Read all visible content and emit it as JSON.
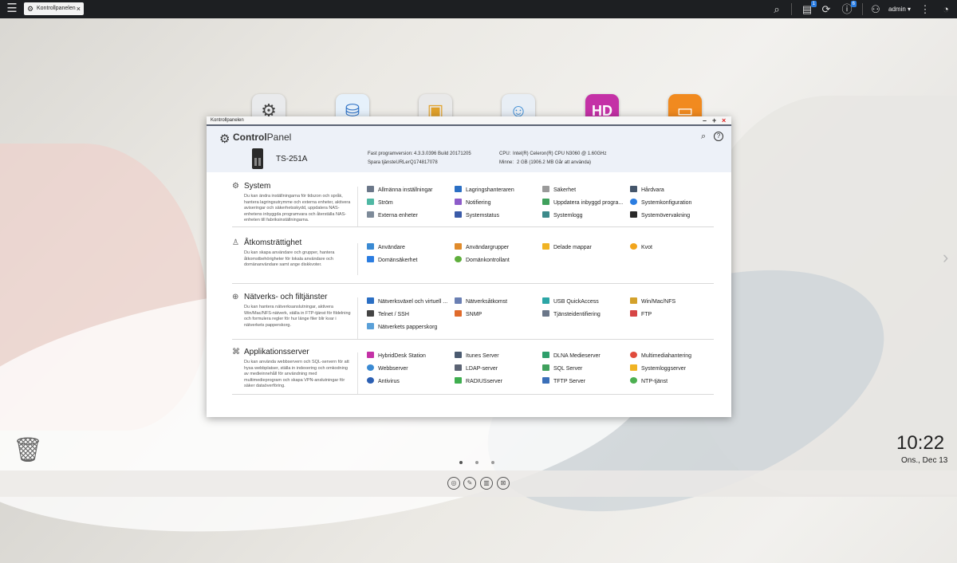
{
  "topbar": {
    "menu_icon": "hamburger-icon",
    "tab_label": "Kontrollpanelen",
    "tab_close": "×",
    "badges": {
      "tasks": "1",
      "info": "6"
    },
    "user": "admin ▾"
  },
  "desktop_icons": [
    "gear-icon",
    "storage-icon",
    "file-station-icon",
    "user-icon",
    "hybriddesk-icon",
    "folder-icon"
  ],
  "window": {
    "title": "Kontrollpanelen",
    "brand_prefix": "Control",
    "brand_suffix": "Panel",
    "model": "TS-251A",
    "firmware_label": "Fast programversion:",
    "firmware_value": "4.3.3.0396 Build 20171205",
    "serial_label": "Spara tjänsteURLer",
    "serial_value": "Q174817078",
    "cpu_label": "CPU:",
    "cpu_value": "Intel(R) Celeron(R) CPU N3060 @ 1.60GHz",
    "memory_label": "Minne:",
    "memory_value": "2 GB (1906.2 MB Går att använda)"
  },
  "sections": [
    {
      "title": "System",
      "desc": "Du kan ändra inställningarna för tidszon och språk, hantera lagringsutrymme och externa enheter, aktivera aviseringar och säkerhetsskydd, uppdatera NAS-enhetens inbyggda programvara och återställa NAS-enheten till fabriksinställningarna.",
      "items": [
        "Allmänna inställningar",
        "Lagringshanteraren",
        "Säkerhet",
        "Hårdvara",
        "Ström",
        "Notifiering",
        "Uppdatera inbyggd progra...",
        "Systemkonfiguration",
        "Externa enheter",
        "Systemstatus",
        "Systemlogg",
        "Systemövervakning"
      ]
    },
    {
      "title": "Åtkomsträttighet",
      "desc": "Du kan skapa användare och grupper, hantera åtkomstbehörigheter för lokala användare och domänanvändare samt ange diskkvoter.",
      "items": [
        "Användare",
        "Användargrupper",
        "Delade mappar",
        "Kvot",
        "Domänsäkerhet",
        "Domänkontrollant"
      ]
    },
    {
      "title": "Nätverks- och filtjänster",
      "desc": "Du kan hantera nätverksanslutningar, aktivera Win/Mac/NFS-nätverk, ställa in FTP-tjänst för fildelning och formulera regler för hur länge filer blir kvar i nätverkets papperskorg.",
      "items": [
        "Nätverksväxel och virtuell ...",
        "Nätverksåtkomst",
        "USB QuickAccess",
        "Win/Mac/NFS",
        "Telnet / SSH",
        "SNMP",
        "Tjänsteidentifiering",
        "FTP",
        "Nätverkets papperskorg"
      ]
    },
    {
      "title": "Applikationsserver",
      "desc": "Du kan använda webbservern och SQL-servern för att hysa webbplatser, ställa in indexering och omkodning av medieinnehåll för användning med multimedieprogram och skapa VPN-anslutningar för säker dataöverföring.",
      "items": [
        "HybridDesk Station",
        "Itunes Server",
        "DLNA Medieserver",
        "Multimediahantering",
        "Webbserver",
        "LDAP-server",
        "SQL Server",
        "Systemloggserver",
        "Antivirus",
        "RADIUSserver",
        "TFTP Server",
        "NTP-tjänst"
      ]
    }
  ],
  "clock": {
    "time": "10:22",
    "date": "Ons., Dec 13"
  },
  "colors": {
    "topbar": "#1d1f22",
    "header_bg": "#edf1f8",
    "accent": "#2b7de1"
  }
}
